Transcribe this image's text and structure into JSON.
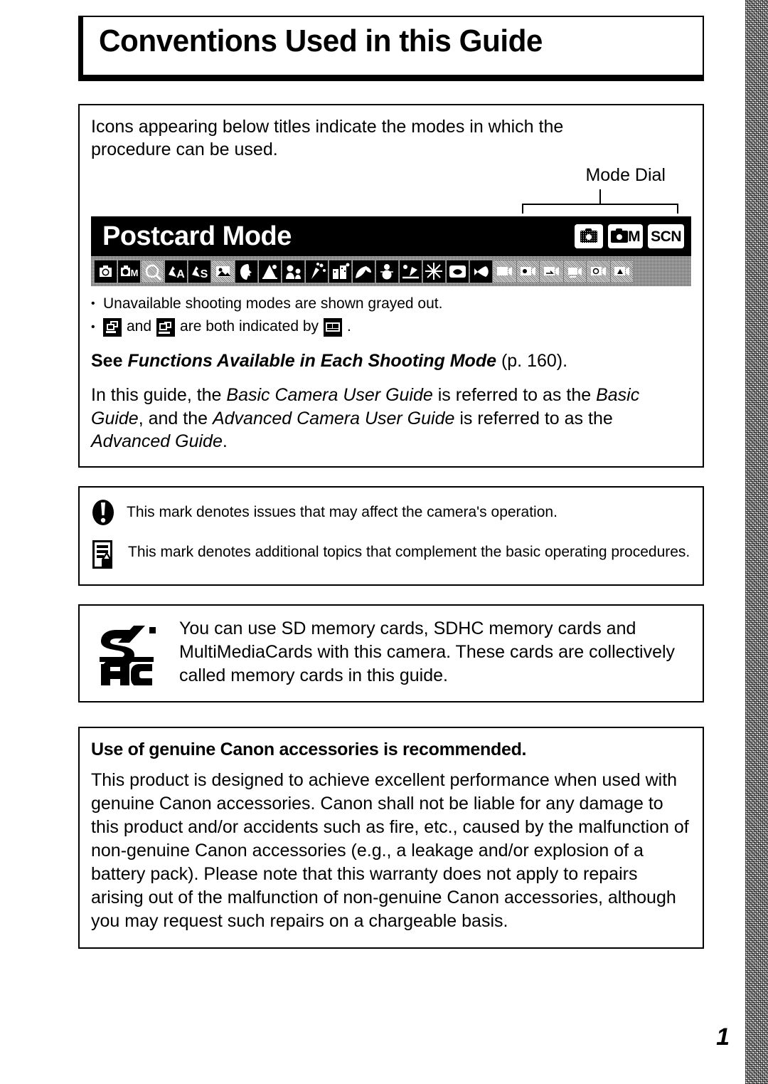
{
  "page": {
    "title": "Conventions Used in this Guide",
    "page_number": "1"
  },
  "intro": {
    "text": "Icons appearing below titles indicate the modes in which the\nprocedure can be used."
  },
  "sample": {
    "mode_dial_label": "Mode Dial",
    "banner_title": "Postcard Mode",
    "mode_badges": [
      {
        "name": "auto-mode-badge",
        "label": "",
        "icon": "camera-auto-icon"
      },
      {
        "name": "manual-mode-badge",
        "label": "M",
        "icon": "camera-icon"
      },
      {
        "name": "scene-mode-badge",
        "label": "SCN",
        "icon": ""
      }
    ],
    "mode_strip": [
      {
        "icon": "camera-auto-icon",
        "available": true
      },
      {
        "icon": "camera-manual-m-icon",
        "available": true
      },
      {
        "icon": "digital-macro-icon",
        "available": false
      },
      {
        "icon": "portrait-a-icon",
        "available": true
      },
      {
        "icon": "portrait-s-icon",
        "available": true
      },
      {
        "icon": "special-scene-icon",
        "available": false
      },
      {
        "icon": "portrait-head-icon",
        "available": true
      },
      {
        "icon": "night-snapshot-icon",
        "available": true
      },
      {
        "icon": "kids-and-pets-icon",
        "available": true
      },
      {
        "icon": "indoor-party-icon",
        "available": true
      },
      {
        "icon": "night-scene-icon",
        "available": true
      },
      {
        "icon": "foliage-icon",
        "available": true
      },
      {
        "icon": "snow-icon",
        "available": true
      },
      {
        "icon": "beach-icon",
        "available": true
      },
      {
        "icon": "fireworks-icon",
        "available": true
      },
      {
        "icon": "aquarium-icon",
        "available": true
      },
      {
        "icon": "underwater-icon",
        "available": true
      },
      {
        "icon": "movie-standard-icon",
        "available": false
      },
      {
        "icon": "movie-color-accent-icon",
        "available": false
      },
      {
        "icon": "movie-color-swap-icon",
        "available": false
      },
      {
        "icon": "movie-compact-icon",
        "available": false
      },
      {
        "icon": "movie-time-lapse-icon",
        "available": false
      },
      {
        "icon": "movie-my-colors-icon",
        "available": false
      }
    ],
    "bullets": {
      "grayed_note": "Unavailable shooting modes are shown grayed out.",
      "combine_pre": "and",
      "combine_mid": "are both indicated by",
      "combine_end": ".",
      "icon_1": "continuous-shooting-icon",
      "icon_2": "continuous-shooting-af-icon",
      "icon_3": "combined-continuous-icon"
    }
  },
  "reference": {
    "see_prefix": "See ",
    "see_title": "Functions Available in Each Shooting Mode",
    "see_suffix": " (p. 160).",
    "guide_p1_a": "In this guide, the ",
    "guide_p1_b": "Basic Camera User Guide",
    "guide_p1_c": " is referred to as the ",
    "guide_p1_d": "Basic Guide",
    "guide_p1_e": ", and the ",
    "guide_p1_f": "Advanced Camera User Guide",
    "guide_p1_g": " is referred to as the ",
    "guide_p1_h": "Advanced Guide",
    "guide_p1_i": "."
  },
  "notes": [
    {
      "icon": "warning-exclamation-icon",
      "text": "This mark denotes issues that may affect the camera's operation."
    },
    {
      "icon": "memo-pencil-icon",
      "text": "This mark denotes additional topics that complement the basic operating procedures."
    }
  ],
  "memory_card": {
    "icon": "sdhc-logo-icon",
    "text": "You can use SD memory cards, SDHC memory cards and MultiMediaCards with this camera. These cards are collectively called memory cards in this guide."
  },
  "canon_notice": {
    "heading": "Use of genuine Canon accessories is recommended.",
    "body": "This product is designed to achieve excellent performance when used with genuine Canon accessories. Canon shall not be liable for any damage to this product and/or accidents such as fire, etc., caused by the malfunction of non-genuine Canon accessories (e.g., a leakage and/or explosion of a battery pack). Please note that this warranty does not apply to repairs arising out of the malfunction of non-genuine Canon accessories, although you may request such repairs on a chargeable basis."
  },
  "colors": {
    "ink": "#000000",
    "paper": "#ffffff",
    "strip_background": "#cfcfcf",
    "edge_band": "#b9b9b9"
  }
}
